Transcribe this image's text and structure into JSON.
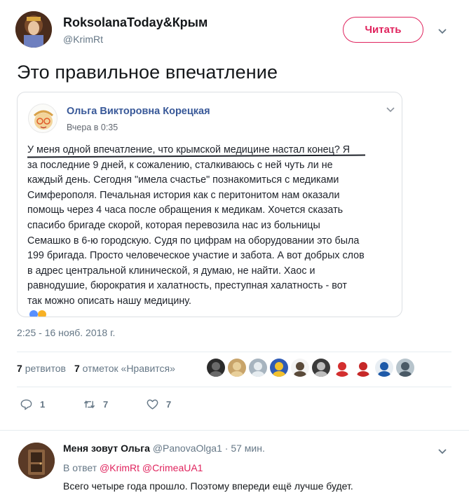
{
  "tweet": {
    "display_name": "RoksolanaToday&Крым",
    "handle": "@KrimRt",
    "follow_label": "Читать",
    "text": "Это правильное впечатление",
    "timestamp": "2:25 - 16 нояб. 2018 г."
  },
  "embed": {
    "author": "Ольга Викторовна Корецкая",
    "time": "Вчера в 0:35",
    "lines": [
      "У меня одной впечатление, что крымской медицине настал конец? Я",
      "за последние 9 дней, к сожалению, сталкиваюсь с ней чуть ли не",
      "каждый день. Сегодня \"имела счастье\" познакомиться с медиками",
      "Симферополя. Печальная история как с перитонитом нам оказали",
      "помощь через 4 часа после обращения к медикам. Хочется сказать",
      "спасибо бригаде скорой, которая перевозила нас из больницы",
      "Семашко в 6-ю городскую. Судя по цифрам на оборудовании это была",
      "199 бригада. Просто человеческое участие и забота. А вот добрых слов",
      "в адрес центральной клинической, я думаю, не найти. Хаос и",
      "равнодушие, бюрократия и халатность, преступная халатность - вот",
      "так можно описать нашу медицину."
    ]
  },
  "stats": {
    "retweets_count": "7",
    "retweets_label": "ретвитов",
    "likes_count": "7",
    "likes_label": "отметок «Нравится»"
  },
  "actions": {
    "replies": "1",
    "retweets": "7",
    "likes": "7"
  },
  "reply": {
    "name": "Меня зовут Ольга",
    "handle": "@PanovaOlga1",
    "meta_sep": " · ",
    "age": "57 мин.",
    "in_reply_prefix": "В ответ ",
    "mention1": "@KrimRt",
    "mention2": "@CrimeaUA1",
    "text": "Всего четыре года прошло. Поэтому впереди ещё лучше будет."
  },
  "liker_avatars": [
    {
      "bg": "#2b2b2b",
      "fg": "#6a6a6a"
    },
    {
      "bg": "#c8a46a",
      "fg": "#e8cf9a"
    },
    {
      "bg": "#a7b4bf",
      "fg": "#e6ecf0"
    },
    {
      "bg": "#2f5bb5",
      "fg": "#f2c12e"
    },
    {
      "bg": "#f4f4f4",
      "fg": "#5a4a3a"
    },
    {
      "bg": "#3a3a3a",
      "fg": "#bdbdbd"
    },
    {
      "bg": "#ffffff",
      "fg": "#d32f2f"
    },
    {
      "bg": "#ffffff",
      "fg": "#c62828"
    },
    {
      "bg": "#e8eef3",
      "fg": "#1e5aa8"
    },
    {
      "bg": "#b7c4cc",
      "fg": "#4a5a66"
    }
  ],
  "colors": {
    "accent": "#e0245e",
    "muted": "#657786",
    "fb_link": "#385898"
  }
}
